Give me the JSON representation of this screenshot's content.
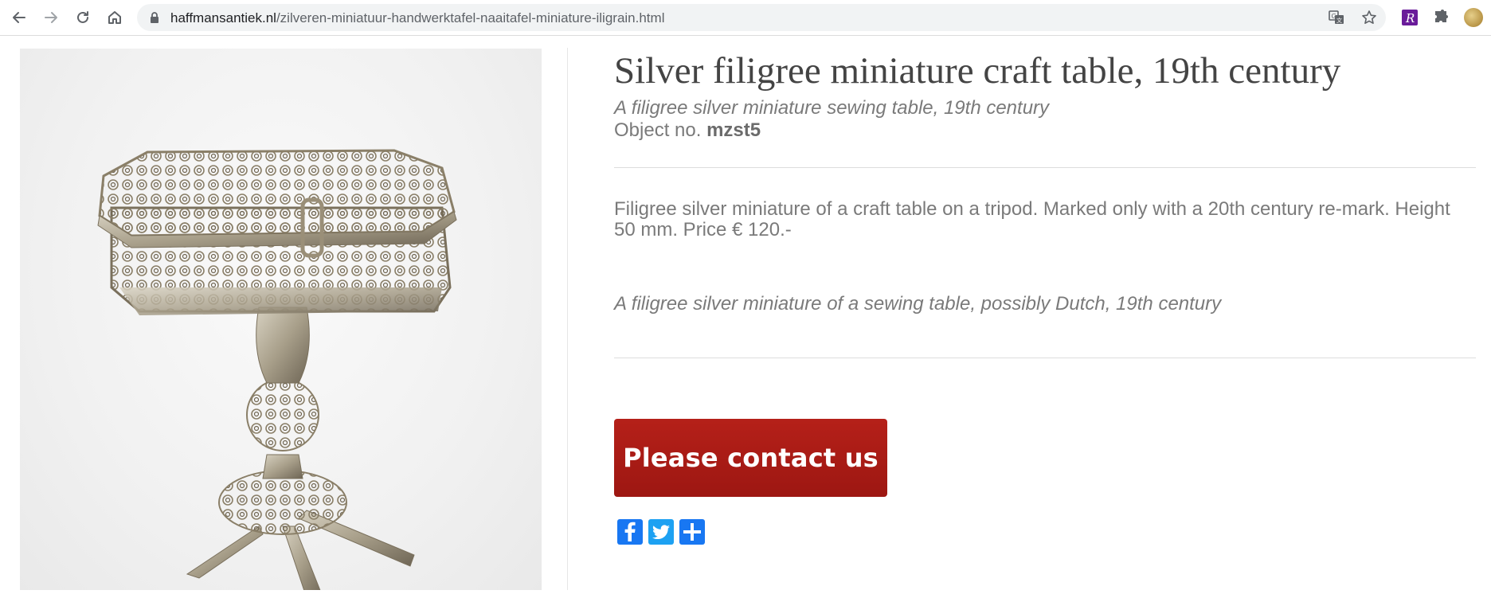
{
  "browser": {
    "url_host": "haffmansantiek.nl",
    "url_path": "/zilveren-miniatuur-handwerktafel-naaitafel-miniature-iligrain.html"
  },
  "product": {
    "title": "Silver filigree miniature craft table, 19th century",
    "subtitle": "A filigree silver miniature sewing table, 19th century",
    "object_label": "Object no.",
    "object_number": "mzst5",
    "description": "Filigree silver miniature of a craft table on a tripod. Marked only with a 20th century re-mark. Height 50 mm. Price € 120.-",
    "description_en": "A filigree silver miniature of a sewing table, possibly Dutch, 19th century",
    "contact_label": "Please contact us"
  },
  "colors": {
    "accent": "#a81b15",
    "facebook": "#1877f2",
    "twitter": "#1da1f2",
    "addthis": "#1877f2"
  },
  "icons": {
    "nav": [
      "back-arrow-icon",
      "forward-arrow-icon",
      "reload-icon",
      "home-icon"
    ],
    "omnibox": [
      "lock-icon",
      "translate-icon",
      "star-icon"
    ],
    "extensions": [
      "extension-r-icon",
      "puzzle-icon",
      "profile-avatar"
    ],
    "share": [
      "facebook-icon",
      "twitter-icon",
      "plus-icon"
    ]
  }
}
